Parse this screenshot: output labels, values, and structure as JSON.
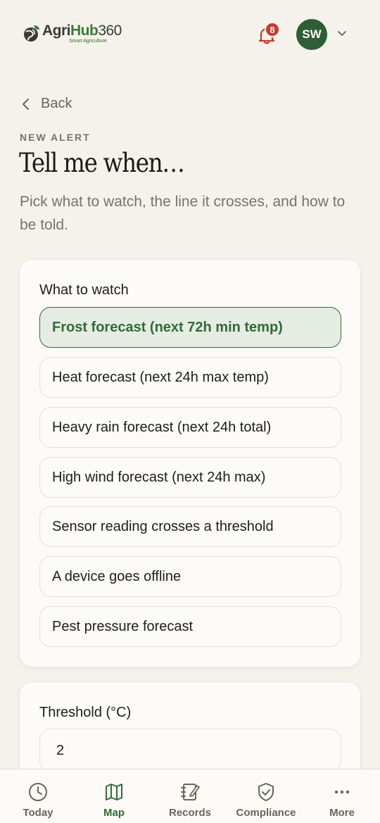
{
  "header": {
    "logo": {
      "brand_a": "Agri",
      "brand_b": "Hub",
      "brand_c": "360",
      "tagline": "Smart Agriculture"
    },
    "notifications_count": "8",
    "avatar_initials": "SW"
  },
  "nav": {
    "back_label": "Back"
  },
  "page": {
    "eyebrow": "NEW ALERT",
    "title": "Tell me when…",
    "subtitle": "Pick what to watch, the line it crosses, and how to be told."
  },
  "watch": {
    "label": "What to watch",
    "options": [
      {
        "label": "Frost forecast (next 72h min temp)",
        "selected": true
      },
      {
        "label": "Heat forecast (next 24h max temp)",
        "selected": false
      },
      {
        "label": "Heavy rain forecast (next 24h total)",
        "selected": false
      },
      {
        "label": "High wind forecast (next 24h max)",
        "selected": false
      },
      {
        "label": "Sensor reading crosses a threshold",
        "selected": false
      },
      {
        "label": "A device goes offline",
        "selected": false
      },
      {
        "label": "Pest pressure forecast",
        "selected": false
      }
    ]
  },
  "threshold": {
    "label": "Threshold (°C)",
    "value": "2"
  },
  "bottom_nav": {
    "items": [
      {
        "label": "Today",
        "icon": "clock-icon",
        "active": false
      },
      {
        "label": "Map",
        "icon": "map-icon",
        "active": true
      },
      {
        "label": "Records",
        "icon": "notebook-icon",
        "active": false
      },
      {
        "label": "Compliance",
        "icon": "shield-check-icon",
        "active": false
      },
      {
        "label": "More",
        "icon": "ellipsis-icon",
        "active": false
      }
    ]
  },
  "colors": {
    "accent": "#2f6b3a",
    "badge": "#c53b2e",
    "background": "#f5f2ec",
    "avatar": "#2e5e35"
  }
}
